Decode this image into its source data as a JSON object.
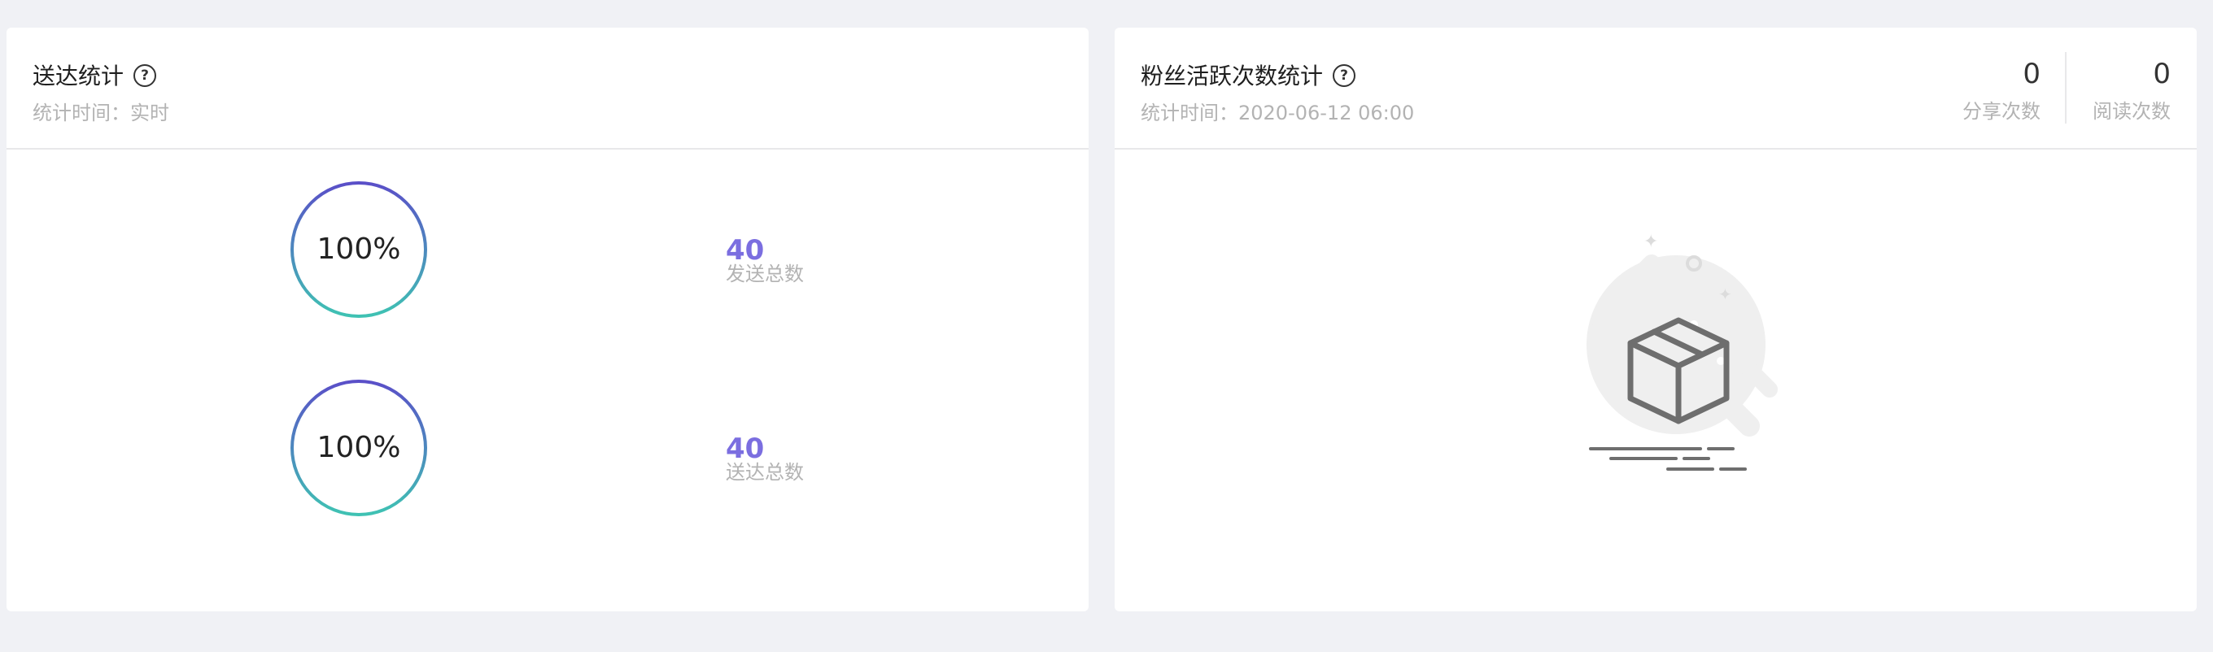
{
  "delivery": {
    "title": "送达统计",
    "subtitle": "统计时间：实时",
    "help_icon": "question-circle-icon",
    "rows": [
      {
        "percent_label": "100%",
        "percent": 1.0,
        "value": "40",
        "label": "发送总数"
      },
      {
        "percent_label": "100%",
        "percent": 1.0,
        "value": "40",
        "label": "送达总数"
      }
    ]
  },
  "fans": {
    "title": "粉丝活跃次数统计",
    "subtitle": "统计时间：2020-06-12 06:00",
    "help_icon": "question-circle-icon",
    "metrics": [
      {
        "value": "0",
        "label": "分享次数"
      },
      {
        "value": "0",
        "label": "阅读次数"
      }
    ],
    "empty_icon": "empty-box-icon"
  },
  "colors": {
    "accent": "#7b6ee0",
    "ring_start": "#5a4fc8",
    "ring_end": "#3fc2b3",
    "background": "#f0f1f5"
  }
}
